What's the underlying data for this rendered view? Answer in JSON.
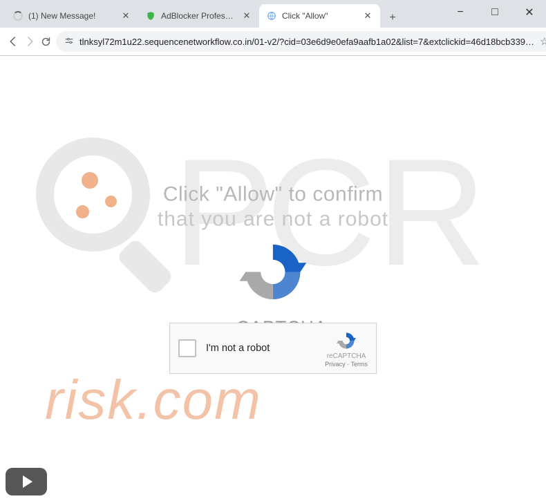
{
  "window": {
    "minimize": "−",
    "maximize": "□",
    "close": "✕"
  },
  "tabs": [
    {
      "title": "(1) New Message!",
      "icon": "spinner",
      "active": false
    },
    {
      "title": "AdBlocker Professional",
      "icon": "shield",
      "active": false
    },
    {
      "title": "Click \"Allow\"",
      "icon": "globe",
      "active": true
    }
  ],
  "toolbar": {
    "url": "tlnksyl72m1u22.sequencenetworkflow.co.in/01-v2/?cid=03e6d9e0efa9aafb1a02&list=7&extclickid=46d18bcb339…"
  },
  "page": {
    "hint_line1": "Click \"Allow\" to confirm",
    "hint_line2": "that you are not a robot",
    "brand": "reCAPTCHA"
  },
  "captcha": {
    "label": "I'm not a robot",
    "brand": "reCAPTCHA",
    "privacy": "Privacy",
    "terms": "Terms",
    "sep": " - "
  },
  "watermark": {
    "risk_text": "risk.com"
  }
}
